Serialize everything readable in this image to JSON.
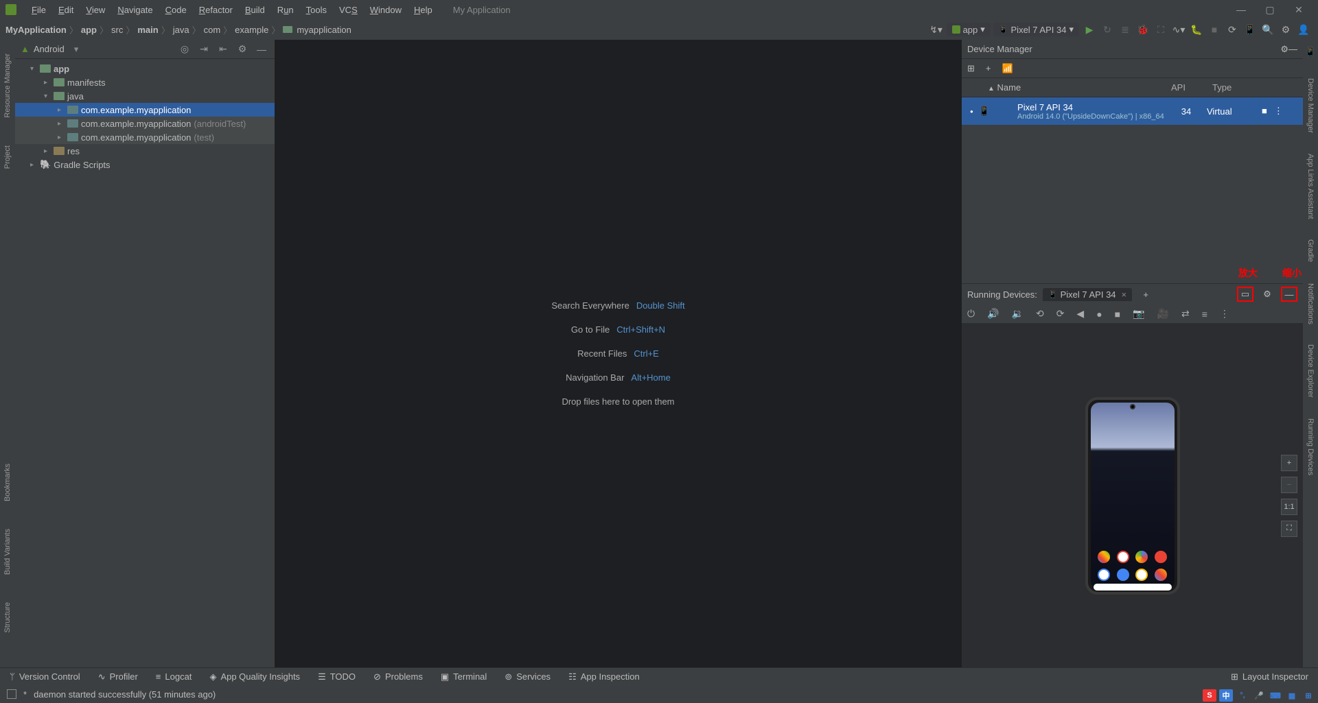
{
  "app_title": "My Application",
  "menu": [
    "File",
    "Edit",
    "View",
    "Navigate",
    "Code",
    "Refactor",
    "Build",
    "Run",
    "Tools",
    "VCS",
    "Window",
    "Help"
  ],
  "breadcrumb": [
    "MyApplication",
    "app",
    "src",
    "main",
    "java",
    "com",
    "example",
    "myapplication"
  ],
  "project_panel": {
    "title": "Android",
    "tree": {
      "root": "app",
      "manifests": "manifests",
      "java": "java",
      "pkg1": "com.example.myapplication",
      "pkg2": "com.example.myapplication",
      "pkg2_note": "(androidTest)",
      "pkg3": "com.example.myapplication",
      "pkg3_note": "(test)",
      "res": "res",
      "gradle": "Gradle Scripts"
    }
  },
  "left_gutter": [
    "Resource Manager",
    "Project",
    "Bookmarks",
    "Build Variants",
    "Structure"
  ],
  "hints": [
    {
      "label": "Search Everywhere",
      "shortcut": "Double Shift"
    },
    {
      "label": "Go to File",
      "shortcut": "Ctrl+Shift+N"
    },
    {
      "label": "Recent Files",
      "shortcut": "Ctrl+E"
    },
    {
      "label": "Navigation Bar",
      "shortcut": "Alt+Home"
    },
    {
      "label": "Drop files here to open them",
      "shortcut": ""
    }
  ],
  "toolbar": {
    "run_config_app": "app",
    "run_config_device": "Pixel 7 API 34"
  },
  "device_manager": {
    "title": "Device Manager",
    "cols": {
      "name": "Name",
      "api": "API",
      "type": "Type"
    },
    "device": {
      "name": "Pixel 7 API 34",
      "sub": "Android 14.0 (\"UpsideDownCake\") | x86_64",
      "api": "34",
      "type": "Virtual"
    }
  },
  "running_devices": {
    "title": "Running Devices:",
    "tab": "Pixel 7 API 34",
    "anno_maximize": "放大",
    "anno_minimize": "缩小",
    "zoom_label": "1:1"
  },
  "right_gutter": [
    "Device Manager",
    "App Links Assistant",
    "Gradle",
    "Notifications",
    "Device Explorer",
    "Running Devices"
  ],
  "bottom_tools": [
    "Version Control",
    "Profiler",
    "Logcat",
    "App Quality Insights",
    "TODO",
    "Problems",
    "Terminal",
    "Services",
    "App Inspection"
  ],
  "bottom_right": "Layout Inspector",
  "status_text": "daemon started successfully (51 minutes ago)"
}
